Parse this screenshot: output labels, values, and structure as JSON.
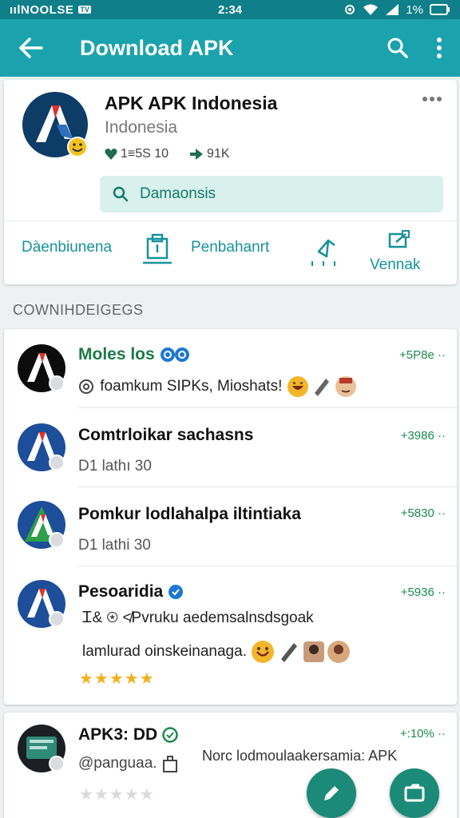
{
  "status_bar": {
    "carrier": "ıılNOOLSE",
    "badge": "TV",
    "time": "2:34",
    "battery": "1%"
  },
  "app_bar": {
    "title": "Download APK",
    "back_icon": "arrow-left-icon",
    "search_icon": "search-icon",
    "menu_icon": "more-vert-icon"
  },
  "profile": {
    "name": "APK APK Indonesia",
    "country": "Indonesia",
    "likes": "1≡5S 10",
    "shares": "91K",
    "search_chip": "Damaonsis",
    "actions": [
      "Dàenbiunena",
      "Penbahanrt",
      "Vennak"
    ]
  },
  "section_label": "COWNIHDEIGEGS",
  "feed": [
    {
      "name": "Moles los",
      "text": "foamkum SIPKs, Mioshats!",
      "time": "+5P8e ··"
    },
    {
      "name": "Comtrloikar sachasns",
      "text": "D1 lathı 30",
      "time": "+3986 ··"
    },
    {
      "name": "Pomkur lodlahalpa iltintiaka",
      "text": "D1 lathi 30",
      "time": "+5830 ··"
    },
    {
      "name": "Pesoaridia",
      "text": "Ꮖ& ⊛ ≮Pvruku aedemsalnsdsgoak",
      "text2": "lamlurad oinskeinanaga.",
      "time": "+5936 ··",
      "rating": "★★★★★"
    },
    {
      "name": "APK3: DD",
      "text": "@panguaa.",
      "text2": "Norc lodmoulaakersamia: APK",
      "time": "+:10% ··",
      "rating": "★★★★★"
    }
  ],
  "colors": {
    "accent": "#1ba3ad",
    "status": "#0f7f89",
    "time_green": "#1b8a4e",
    "fab": "#1b8a78"
  }
}
